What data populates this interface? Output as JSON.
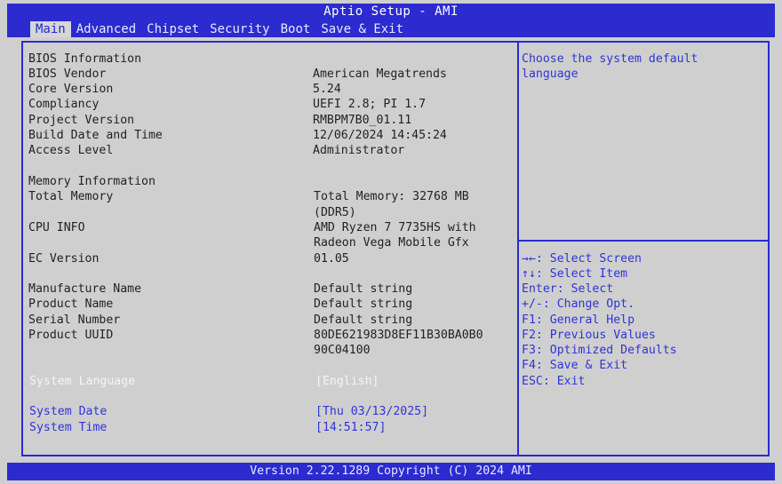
{
  "app": {
    "title": "Aptio Setup - AMI"
  },
  "tabs": [
    "Main",
    "Advanced",
    "Chipset",
    "Security",
    "Boot",
    "Save & Exit"
  ],
  "main": {
    "bios_info_header": "BIOS Information",
    "bios_vendor": {
      "label": "BIOS Vendor",
      "value": "American Megatrends"
    },
    "core_version": {
      "label": "Core Version",
      "value": "5.24"
    },
    "compliancy": {
      "label": "Compliancy",
      "value": "UEFI 2.8; PI 1.7"
    },
    "project_version": {
      "label": "Project Version",
      "value": "RMBPM7B0_01.11"
    },
    "build_date": {
      "label": "Build Date and Time",
      "value": "12/06/2024 14:45:24"
    },
    "access_level": {
      "label": "Access Level",
      "value": "Administrator"
    },
    "memory_info_header": "Memory Information",
    "total_memory": {
      "label": "Total Memory",
      "value_line1": "Total Memory: 32768 MB",
      "value_line2": "(DDR5)"
    },
    "cpu_info": {
      "label": "CPU INFO",
      "value_line1": "AMD Ryzen 7 7735HS with",
      "value_line2": "Radeon Vega Mobile Gfx"
    },
    "ec_version": {
      "label": "EC Version",
      "value": "01.05"
    },
    "manufacture_name": {
      "label": "Manufacture Name",
      "value": "Default string"
    },
    "product_name": {
      "label": "Product Name",
      "value": "Default string"
    },
    "serial_number": {
      "label": "Serial Number",
      "value": "Default string"
    },
    "product_uuid": {
      "label": "Product UUID",
      "value_line1": "80DE621983D8EF11B30BA0B0",
      "value_line2": "90C04100"
    },
    "system_language": {
      "label": "System Language",
      "value": "[English]"
    },
    "system_date": {
      "label": "System Date",
      "value": "[Thu 03/13/2025]"
    },
    "system_time": {
      "label": "System Time",
      "value": "[14:51:57]"
    }
  },
  "help": {
    "description_line1": "Choose the system default",
    "description_line2": "language",
    "keys": [
      "→←: Select Screen",
      "↑↓: Select Item",
      "Enter: Select",
      "+/-: Change Opt.",
      "F1: General Help",
      "F2: Previous Values",
      "F3: Optimized Defaults",
      "F4: Save & Exit",
      "ESC: Exit"
    ]
  },
  "footer": {
    "text": "Version 2.22.1289 Copyright (C) 2024 AMI"
  }
}
